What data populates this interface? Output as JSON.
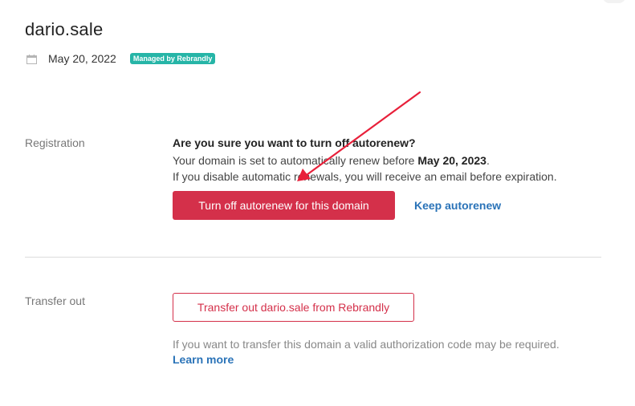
{
  "header": {
    "domain": "dario.sale",
    "date": "May 20, 2022",
    "badge": "Managed by Rebrandly"
  },
  "registration": {
    "label": "Registration",
    "confirm_title": "Are you sure you want to turn off autorenew?",
    "line1_prefix": "Your domain is set to automatically renew before ",
    "line1_date": "May 20, 2023",
    "line1_suffix": ".",
    "line2": "If you disable automatic renewals, you will receive an email before expiration.",
    "turn_off_button": "Turn off autorenew for this domain",
    "keep_link": "Keep autorenew"
  },
  "transfer": {
    "label": "Transfer out",
    "button": "Transfer out dario.sale from Rebrandly",
    "help_text": "If you want to transfer this domain a valid authorization code may be required.",
    "learn_more": "Learn more"
  },
  "colors": {
    "accent_red": "#d4304a",
    "link_blue": "#2a73b8",
    "badge_teal": "#26b5a7",
    "arrow_red": "#e8203a"
  },
  "icons": {
    "date": "calendar-icon",
    "annotation": "annotation-arrow"
  }
}
